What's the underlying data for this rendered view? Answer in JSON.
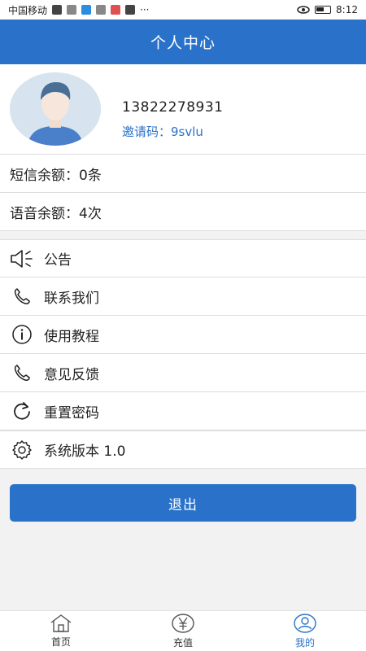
{
  "status_bar": {
    "carrier": "中国移动",
    "time": "8:12",
    "icons": [
      "hd-icon",
      "signal-icon",
      "wifi-icon",
      "app-notification-icons",
      "more-dots",
      "eye-icon",
      "battery-icon"
    ],
    "more": "···"
  },
  "header": {
    "title": "个人中心"
  },
  "profile": {
    "phone": "13822278931",
    "invite_label": "邀请码：",
    "invite_code": "9svlu"
  },
  "balances": [
    {
      "label": "短信余额：0条"
    },
    {
      "label": "语音余额：4次"
    }
  ],
  "menu": [
    {
      "label": "公告",
      "icon": "speaker-icon"
    },
    {
      "label": "联系我们",
      "icon": "phone-icon"
    },
    {
      "label": "使用教程",
      "icon": "info-icon"
    },
    {
      "label": "意见反馈",
      "icon": "phone-icon"
    },
    {
      "label": "重置密码",
      "icon": "refresh-icon"
    },
    {
      "label": "系统版本  1.0",
      "icon": "gear-icon"
    }
  ],
  "logout": {
    "label": "退出"
  },
  "tabs": [
    {
      "label": "首页",
      "icon": "home-icon",
      "active": false
    },
    {
      "label": "充值",
      "icon": "yen-icon",
      "active": false
    },
    {
      "label": "我的",
      "icon": "user-icon",
      "active": true
    }
  ],
  "colors": {
    "primary": "#2a72c9",
    "background": "#f2f2f2"
  }
}
